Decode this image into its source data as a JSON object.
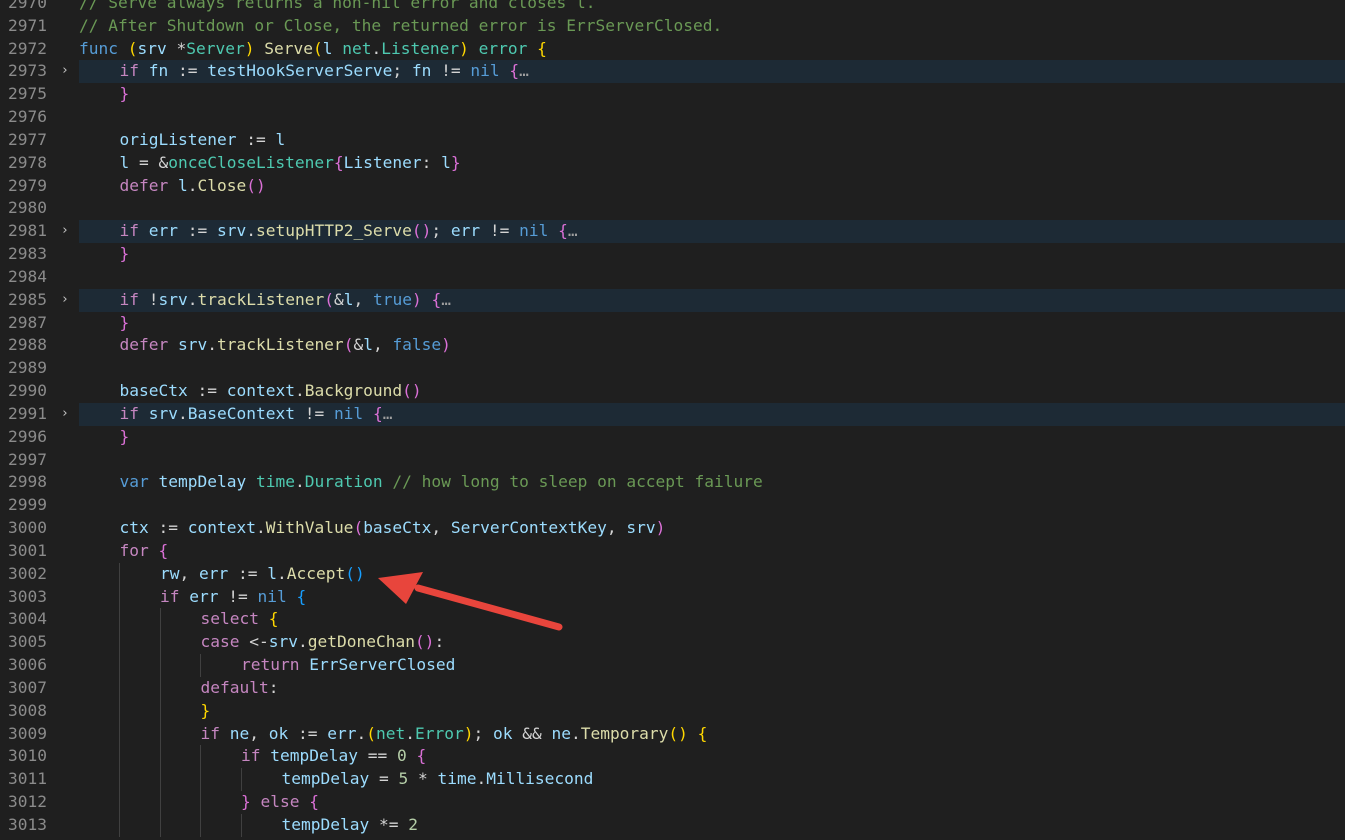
{
  "editor": {
    "language": "go",
    "annotation_arrow_color": "#e8453c",
    "folded_line_bg": "#1d2a35",
    "lines": [
      {
        "num": "2970",
        "folded": false,
        "indent": 0,
        "tokens": [
          {
            "t": "// Serve always returns a non-nil error and closes l.",
            "c": "cmt"
          }
        ]
      },
      {
        "num": "2971",
        "folded": false,
        "indent": 0,
        "tokens": [
          {
            "t": "// After Shutdown or Close, the returned error is ErrServerClosed.",
            "c": "cmt"
          }
        ]
      },
      {
        "num": "2972",
        "folded": false,
        "indent": 0,
        "tokens": [
          {
            "t": "func",
            "c": "decl"
          },
          {
            "t": " ",
            "c": "plain"
          },
          {
            "t": "(",
            "c": "b1"
          },
          {
            "t": "srv",
            "c": "var"
          },
          {
            "t": " *",
            "c": "plain"
          },
          {
            "t": "Server",
            "c": "type"
          },
          {
            "t": ")",
            "c": "b1"
          },
          {
            "t": " ",
            "c": "plain"
          },
          {
            "t": "Serve",
            "c": "fn"
          },
          {
            "t": "(",
            "c": "b1"
          },
          {
            "t": "l",
            "c": "var"
          },
          {
            "t": " ",
            "c": "plain"
          },
          {
            "t": "net",
            "c": "type"
          },
          {
            "t": ".",
            "c": "plain"
          },
          {
            "t": "Listener",
            "c": "type"
          },
          {
            "t": ")",
            "c": "b1"
          },
          {
            "t": " ",
            "c": "plain"
          },
          {
            "t": "error",
            "c": "type"
          },
          {
            "t": " ",
            "c": "plain"
          },
          {
            "t": "{",
            "c": "b1"
          }
        ]
      },
      {
        "num": "2973",
        "folded": true,
        "indent": 1,
        "tokens": [
          {
            "t": "if",
            "c": "kw"
          },
          {
            "t": " ",
            "c": "plain"
          },
          {
            "t": "fn",
            "c": "var"
          },
          {
            "t": " := ",
            "c": "plain"
          },
          {
            "t": "testHookServerServe",
            "c": "var"
          },
          {
            "t": "; ",
            "c": "plain"
          },
          {
            "t": "fn",
            "c": "var"
          },
          {
            "t": " != ",
            "c": "plain"
          },
          {
            "t": "nil",
            "c": "decl"
          },
          {
            "t": " ",
            "c": "plain"
          },
          {
            "t": "{",
            "c": "b2"
          },
          {
            "t": "…",
            "c": "ell"
          }
        ]
      },
      {
        "num": "2975",
        "folded": false,
        "indent": 1,
        "tokens": [
          {
            "t": "}",
            "c": "b2"
          }
        ]
      },
      {
        "num": "2976",
        "folded": false,
        "indent": 1,
        "tokens": []
      },
      {
        "num": "2977",
        "folded": false,
        "indent": 1,
        "tokens": [
          {
            "t": "origListener",
            "c": "var"
          },
          {
            "t": " := ",
            "c": "plain"
          },
          {
            "t": "l",
            "c": "var"
          }
        ]
      },
      {
        "num": "2978",
        "folded": false,
        "indent": 1,
        "tokens": [
          {
            "t": "l",
            "c": "var"
          },
          {
            "t": " = &",
            "c": "plain"
          },
          {
            "t": "onceCloseListener",
            "c": "type"
          },
          {
            "t": "{",
            "c": "b2"
          },
          {
            "t": "Listener",
            "c": "prop"
          },
          {
            "t": ": ",
            "c": "plain"
          },
          {
            "t": "l",
            "c": "var"
          },
          {
            "t": "}",
            "c": "b2"
          }
        ]
      },
      {
        "num": "2979",
        "folded": false,
        "indent": 1,
        "tokens": [
          {
            "t": "defer",
            "c": "kw"
          },
          {
            "t": " ",
            "c": "plain"
          },
          {
            "t": "l",
            "c": "var"
          },
          {
            "t": ".",
            "c": "plain"
          },
          {
            "t": "Close",
            "c": "fn"
          },
          {
            "t": "()",
            "c": "b2"
          }
        ]
      },
      {
        "num": "2980",
        "folded": false,
        "indent": 1,
        "tokens": []
      },
      {
        "num": "2981",
        "folded": true,
        "indent": 1,
        "tokens": [
          {
            "t": "if",
            "c": "kw"
          },
          {
            "t": " ",
            "c": "plain"
          },
          {
            "t": "err",
            "c": "var"
          },
          {
            "t": " := ",
            "c": "plain"
          },
          {
            "t": "srv",
            "c": "var"
          },
          {
            "t": ".",
            "c": "plain"
          },
          {
            "t": "setupHTTP2_Serve",
            "c": "fn"
          },
          {
            "t": "()",
            "c": "b2"
          },
          {
            "t": "; ",
            "c": "plain"
          },
          {
            "t": "err",
            "c": "var"
          },
          {
            "t": " != ",
            "c": "plain"
          },
          {
            "t": "nil",
            "c": "decl"
          },
          {
            "t": " ",
            "c": "plain"
          },
          {
            "t": "{",
            "c": "b2"
          },
          {
            "t": "…",
            "c": "ell"
          }
        ]
      },
      {
        "num": "2983",
        "folded": false,
        "indent": 1,
        "tokens": [
          {
            "t": "}",
            "c": "b2"
          }
        ]
      },
      {
        "num": "2984",
        "folded": false,
        "indent": 1,
        "tokens": []
      },
      {
        "num": "2985",
        "folded": true,
        "indent": 1,
        "tokens": [
          {
            "t": "if",
            "c": "kw"
          },
          {
            "t": " !",
            "c": "plain"
          },
          {
            "t": "srv",
            "c": "var"
          },
          {
            "t": ".",
            "c": "plain"
          },
          {
            "t": "trackListener",
            "c": "fn"
          },
          {
            "t": "(",
            "c": "b2"
          },
          {
            "t": "&",
            "c": "plain"
          },
          {
            "t": "l",
            "c": "var"
          },
          {
            "t": ", ",
            "c": "plain"
          },
          {
            "t": "true",
            "c": "decl"
          },
          {
            "t": ")",
            "c": "b2"
          },
          {
            "t": " ",
            "c": "plain"
          },
          {
            "t": "{",
            "c": "b2"
          },
          {
            "t": "…",
            "c": "ell"
          }
        ]
      },
      {
        "num": "2987",
        "folded": false,
        "indent": 1,
        "tokens": [
          {
            "t": "}",
            "c": "b2"
          }
        ]
      },
      {
        "num": "2988",
        "folded": false,
        "indent": 1,
        "tokens": [
          {
            "t": "defer",
            "c": "kw"
          },
          {
            "t": " ",
            "c": "plain"
          },
          {
            "t": "srv",
            "c": "var"
          },
          {
            "t": ".",
            "c": "plain"
          },
          {
            "t": "trackListener",
            "c": "fn"
          },
          {
            "t": "(",
            "c": "b2"
          },
          {
            "t": "&",
            "c": "plain"
          },
          {
            "t": "l",
            "c": "var"
          },
          {
            "t": ", ",
            "c": "plain"
          },
          {
            "t": "false",
            "c": "decl"
          },
          {
            "t": ")",
            "c": "b2"
          }
        ]
      },
      {
        "num": "2989",
        "folded": false,
        "indent": 1,
        "tokens": []
      },
      {
        "num": "2990",
        "folded": false,
        "indent": 1,
        "tokens": [
          {
            "t": "baseCtx",
            "c": "var"
          },
          {
            "t": " := ",
            "c": "plain"
          },
          {
            "t": "context",
            "c": "var"
          },
          {
            "t": ".",
            "c": "plain"
          },
          {
            "t": "Background",
            "c": "fn"
          },
          {
            "t": "()",
            "c": "b2"
          }
        ]
      },
      {
        "num": "2991",
        "folded": true,
        "indent": 1,
        "tokens": [
          {
            "t": "if",
            "c": "kw"
          },
          {
            "t": " ",
            "c": "plain"
          },
          {
            "t": "srv",
            "c": "var"
          },
          {
            "t": ".",
            "c": "plain"
          },
          {
            "t": "BaseContext",
            "c": "prop"
          },
          {
            "t": " != ",
            "c": "plain"
          },
          {
            "t": "nil",
            "c": "decl"
          },
          {
            "t": " ",
            "c": "plain"
          },
          {
            "t": "{",
            "c": "b2"
          },
          {
            "t": "…",
            "c": "ell"
          }
        ]
      },
      {
        "num": "2996",
        "folded": false,
        "indent": 1,
        "tokens": [
          {
            "t": "}",
            "c": "b2"
          }
        ]
      },
      {
        "num": "2997",
        "folded": false,
        "indent": 1,
        "tokens": []
      },
      {
        "num": "2998",
        "folded": false,
        "indent": 1,
        "tokens": [
          {
            "t": "var",
            "c": "decl"
          },
          {
            "t": " ",
            "c": "plain"
          },
          {
            "t": "tempDelay",
            "c": "var"
          },
          {
            "t": " ",
            "c": "plain"
          },
          {
            "t": "time",
            "c": "type"
          },
          {
            "t": ".",
            "c": "plain"
          },
          {
            "t": "Duration",
            "c": "type"
          },
          {
            "t": " ",
            "c": "plain"
          },
          {
            "t": "// how long to sleep on accept failure",
            "c": "cmt"
          }
        ]
      },
      {
        "num": "2999",
        "folded": false,
        "indent": 1,
        "tokens": []
      },
      {
        "num": "3000",
        "folded": false,
        "indent": 1,
        "tokens": [
          {
            "t": "ctx",
            "c": "var"
          },
          {
            "t": " := ",
            "c": "plain"
          },
          {
            "t": "context",
            "c": "var"
          },
          {
            "t": ".",
            "c": "plain"
          },
          {
            "t": "WithValue",
            "c": "fn"
          },
          {
            "t": "(",
            "c": "b2"
          },
          {
            "t": "baseCtx",
            "c": "var"
          },
          {
            "t": ", ",
            "c": "plain"
          },
          {
            "t": "ServerContextKey",
            "c": "var"
          },
          {
            "t": ", ",
            "c": "plain"
          },
          {
            "t": "srv",
            "c": "var"
          },
          {
            "t": ")",
            "c": "b2"
          }
        ]
      },
      {
        "num": "3001",
        "folded": false,
        "indent": 1,
        "tokens": [
          {
            "t": "for",
            "c": "kw"
          },
          {
            "t": " ",
            "c": "plain"
          },
          {
            "t": "{",
            "c": "b2"
          }
        ]
      },
      {
        "num": "3002",
        "folded": false,
        "indent": 2,
        "tokens": [
          {
            "t": "rw",
            "c": "var"
          },
          {
            "t": ", ",
            "c": "plain"
          },
          {
            "t": "err",
            "c": "var"
          },
          {
            "t": " := ",
            "c": "plain"
          },
          {
            "t": "l",
            "c": "var"
          },
          {
            "t": ".",
            "c": "plain"
          },
          {
            "t": "Accept",
            "c": "fn"
          },
          {
            "t": "()",
            "c": "b3"
          }
        ]
      },
      {
        "num": "3003",
        "folded": false,
        "indent": 2,
        "tokens": [
          {
            "t": "if",
            "c": "kw"
          },
          {
            "t": " ",
            "c": "plain"
          },
          {
            "t": "err",
            "c": "var"
          },
          {
            "t": " != ",
            "c": "plain"
          },
          {
            "t": "nil",
            "c": "decl"
          },
          {
            "t": " ",
            "c": "plain"
          },
          {
            "t": "{",
            "c": "b3"
          }
        ]
      },
      {
        "num": "3004",
        "folded": false,
        "indent": 3,
        "tokens": [
          {
            "t": "select",
            "c": "kw"
          },
          {
            "t": " ",
            "c": "plain"
          },
          {
            "t": "{",
            "c": "b1"
          }
        ]
      },
      {
        "num": "3005",
        "folded": false,
        "indent": 3,
        "tokens": [
          {
            "t": "case",
            "c": "kw"
          },
          {
            "t": " <-",
            "c": "plain"
          },
          {
            "t": "srv",
            "c": "var"
          },
          {
            "t": ".",
            "c": "plain"
          },
          {
            "t": "getDoneChan",
            "c": "fn"
          },
          {
            "t": "()",
            "c": "b2"
          },
          {
            "t": ":",
            "c": "plain"
          }
        ]
      },
      {
        "num": "3006",
        "folded": false,
        "indent": 4,
        "tokens": [
          {
            "t": "return",
            "c": "kw"
          },
          {
            "t": " ",
            "c": "plain"
          },
          {
            "t": "ErrServerClosed",
            "c": "var"
          }
        ]
      },
      {
        "num": "3007",
        "folded": false,
        "indent": 3,
        "tokens": [
          {
            "t": "default",
            "c": "kw"
          },
          {
            "t": ":",
            "c": "plain"
          }
        ]
      },
      {
        "num": "3008",
        "folded": false,
        "indent": 3,
        "tokens": [
          {
            "t": "}",
            "c": "b1"
          }
        ]
      },
      {
        "num": "3009",
        "folded": false,
        "indent": 3,
        "tokens": [
          {
            "t": "if",
            "c": "kw"
          },
          {
            "t": " ",
            "c": "plain"
          },
          {
            "t": "ne",
            "c": "var"
          },
          {
            "t": ", ",
            "c": "plain"
          },
          {
            "t": "ok",
            "c": "var"
          },
          {
            "t": " := ",
            "c": "plain"
          },
          {
            "t": "err",
            "c": "var"
          },
          {
            "t": ".",
            "c": "plain"
          },
          {
            "t": "(",
            "c": "b1"
          },
          {
            "t": "net",
            "c": "type"
          },
          {
            "t": ".",
            "c": "plain"
          },
          {
            "t": "Error",
            "c": "type"
          },
          {
            "t": ")",
            "c": "b1"
          },
          {
            "t": "; ",
            "c": "plain"
          },
          {
            "t": "ok",
            "c": "var"
          },
          {
            "t": " && ",
            "c": "plain"
          },
          {
            "t": "ne",
            "c": "var"
          },
          {
            "t": ".",
            "c": "plain"
          },
          {
            "t": "Temporary",
            "c": "fn"
          },
          {
            "t": "()",
            "c": "b1"
          },
          {
            "t": " ",
            "c": "plain"
          },
          {
            "t": "{",
            "c": "b1"
          }
        ]
      },
      {
        "num": "3010",
        "folded": false,
        "indent": 4,
        "tokens": [
          {
            "t": "if",
            "c": "kw"
          },
          {
            "t": " ",
            "c": "plain"
          },
          {
            "t": "tempDelay",
            "c": "var"
          },
          {
            "t": " == ",
            "c": "plain"
          },
          {
            "t": "0",
            "c": "num"
          },
          {
            "t": " ",
            "c": "plain"
          },
          {
            "t": "{",
            "c": "b2"
          }
        ]
      },
      {
        "num": "3011",
        "folded": false,
        "indent": 5,
        "tokens": [
          {
            "t": "tempDelay",
            "c": "var"
          },
          {
            "t": " = ",
            "c": "plain"
          },
          {
            "t": "5",
            "c": "num"
          },
          {
            "t": " * ",
            "c": "plain"
          },
          {
            "t": "time",
            "c": "var"
          },
          {
            "t": ".",
            "c": "plain"
          },
          {
            "t": "Millisecond",
            "c": "var"
          }
        ]
      },
      {
        "num": "3012",
        "folded": false,
        "indent": 4,
        "tokens": [
          {
            "t": "}",
            "c": "b2"
          },
          {
            "t": " ",
            "c": "plain"
          },
          {
            "t": "else",
            "c": "kw"
          },
          {
            "t": " ",
            "c": "plain"
          },
          {
            "t": "{",
            "c": "b2"
          }
        ]
      },
      {
        "num": "3013",
        "folded": false,
        "indent": 5,
        "tokens": [
          {
            "t": "tempDelay",
            "c": "var"
          },
          {
            "t": " *= ",
            "c": "plain"
          },
          {
            "t": "2",
            "c": "num"
          }
        ]
      }
    ]
  }
}
